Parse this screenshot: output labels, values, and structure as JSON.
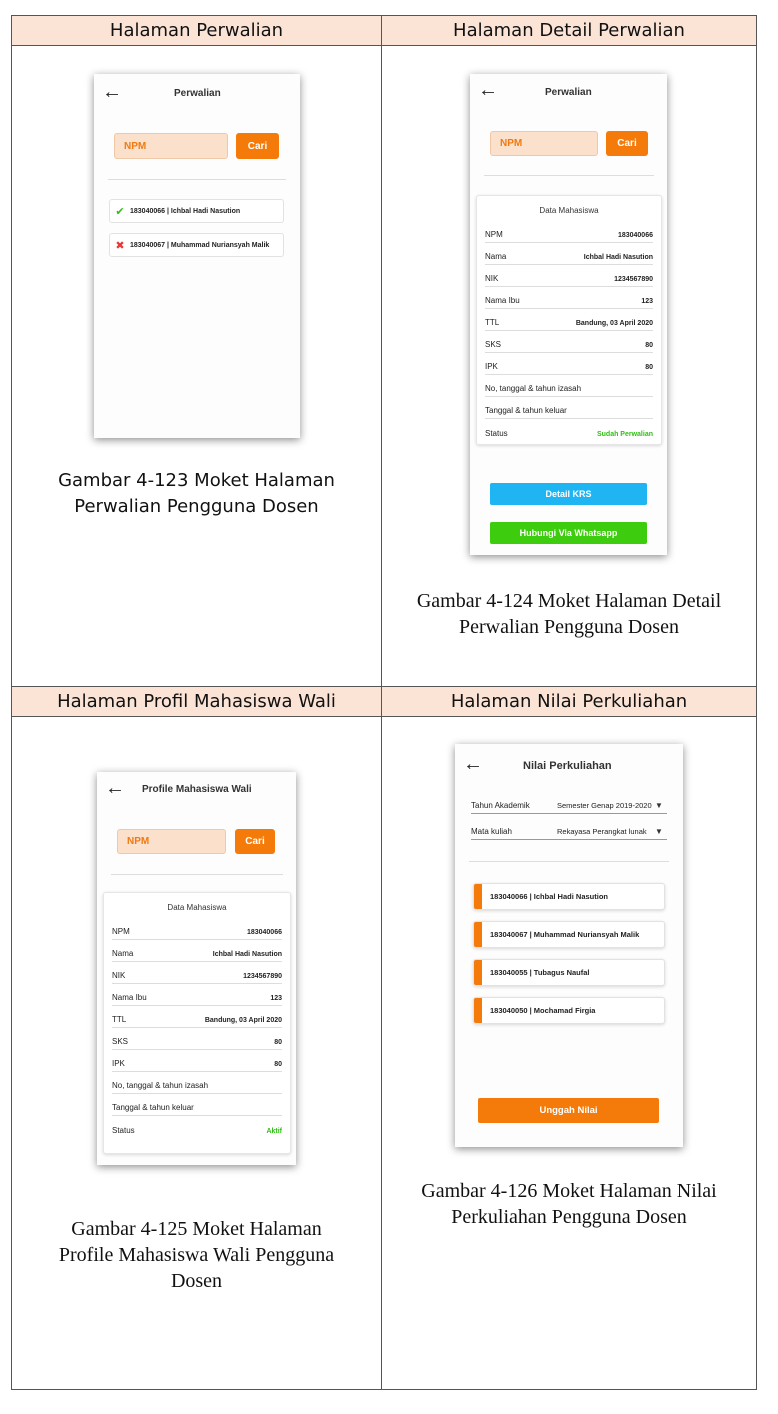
{
  "headers": [
    "Halaman Perwalian",
    "Halaman Detail Perwalian",
    "Halaman Profil Mahasiswa Wali",
    "Halaman Nilai Perkuliahan"
  ],
  "captions": {
    "c1": [
      "Gambar 4-123 Moket Halaman",
      "Perwalian Pengguna Dosen"
    ],
    "c2": [
      "Gambar 4-124 Moket Halaman Detail",
      "Perwalian Pengguna Dosen"
    ],
    "c3": [
      "Gambar 4-125 Moket Halaman",
      "Profile Mahasiswa Wali Pengguna",
      "Dosen"
    ],
    "c4": [
      "Gambar 4-126 Moket Halaman Nilai",
      "Perkuliahan Pengguna Dosen"
    ]
  },
  "icons": {
    "back": "arrow-left-icon",
    "ok": "check-icon",
    "fail": "cross-icon",
    "dropdown": "caret-down-icon"
  },
  "colors": {
    "accent": "#f47b0a",
    "green": "#3ecc0e",
    "blue": "#1fb4f2",
    "header_bg": "#fbe3d6"
  },
  "m1": {
    "title": "Perwalian",
    "npm_placeholder": "NPM",
    "search_label": "Cari",
    "items": [
      {
        "text": "183040066 | Ichbal Hadi Nasution",
        "status": "ok"
      },
      {
        "text": "183040067 | Muhammad Nuriansyah Malik",
        "status": "fail"
      }
    ]
  },
  "m2": {
    "title": "Perwalian",
    "npm_placeholder": "NPM",
    "search_label": "Cari",
    "card_title": "Data Mahasiswa",
    "rows": [
      {
        "label": "NPM",
        "value": "183040066"
      },
      {
        "label": "Nama",
        "value": "Ichbal Hadi Nasution"
      },
      {
        "label": "NIK",
        "value": "1234567890"
      },
      {
        "label": "Nama Ibu",
        "value": "123"
      },
      {
        "label": "TTL",
        "value": "Bandung, 03 April 2020"
      },
      {
        "label": "SKS",
        "value": "80"
      },
      {
        "label": "IPK",
        "value": "80"
      },
      {
        "label": "No, tanggal & tahun izasah",
        "value": ""
      },
      {
        "label": "Tanggal & tahun keluar",
        "value": ""
      },
      {
        "label": "Status",
        "value": "Sudah Perwalian"
      }
    ],
    "detail_button": "Detail KRS",
    "whatsapp_button": "Hubungi Via Whatsapp"
  },
  "m3": {
    "title": "Profile Mahasiswa Wali",
    "npm_placeholder": "NPM",
    "search_label": "Cari",
    "card_title": "Data Mahasiswa",
    "rows": [
      {
        "label": "NPM",
        "value": "183040066"
      },
      {
        "label": "Nama",
        "value": "Ichbal Hadi Nasution"
      },
      {
        "label": "NIK",
        "value": "1234567890"
      },
      {
        "label": "Nama Ibu",
        "value": "123"
      },
      {
        "label": "TTL",
        "value": "Bandung, 03 April 2020"
      },
      {
        "label": "SKS",
        "value": "80"
      },
      {
        "label": "IPK",
        "value": "80"
      },
      {
        "label": "No, tanggal & tahun izasah",
        "value": ""
      },
      {
        "label": "Tanggal & tahun keluar",
        "value": ""
      },
      {
        "label": "Status",
        "value": "Aktif"
      }
    ]
  },
  "m4": {
    "title": "Nilai Perkuliahan",
    "academic_year_label": "Tahun Akademik",
    "academic_year_value": "Semester Genap 2019-2020",
    "course_label": "Mata kuliah",
    "course_value": "Rekayasa Perangkat lunak",
    "students": [
      "183040066 | Ichbal Hadi Nasution",
      "183040067 | Muhammad Nuriansyah Malik",
      "183040055 | Tubagus Naufal",
      "183040050 | Mochamad Firgia"
    ],
    "upload_button": "Unggah Nilai"
  }
}
